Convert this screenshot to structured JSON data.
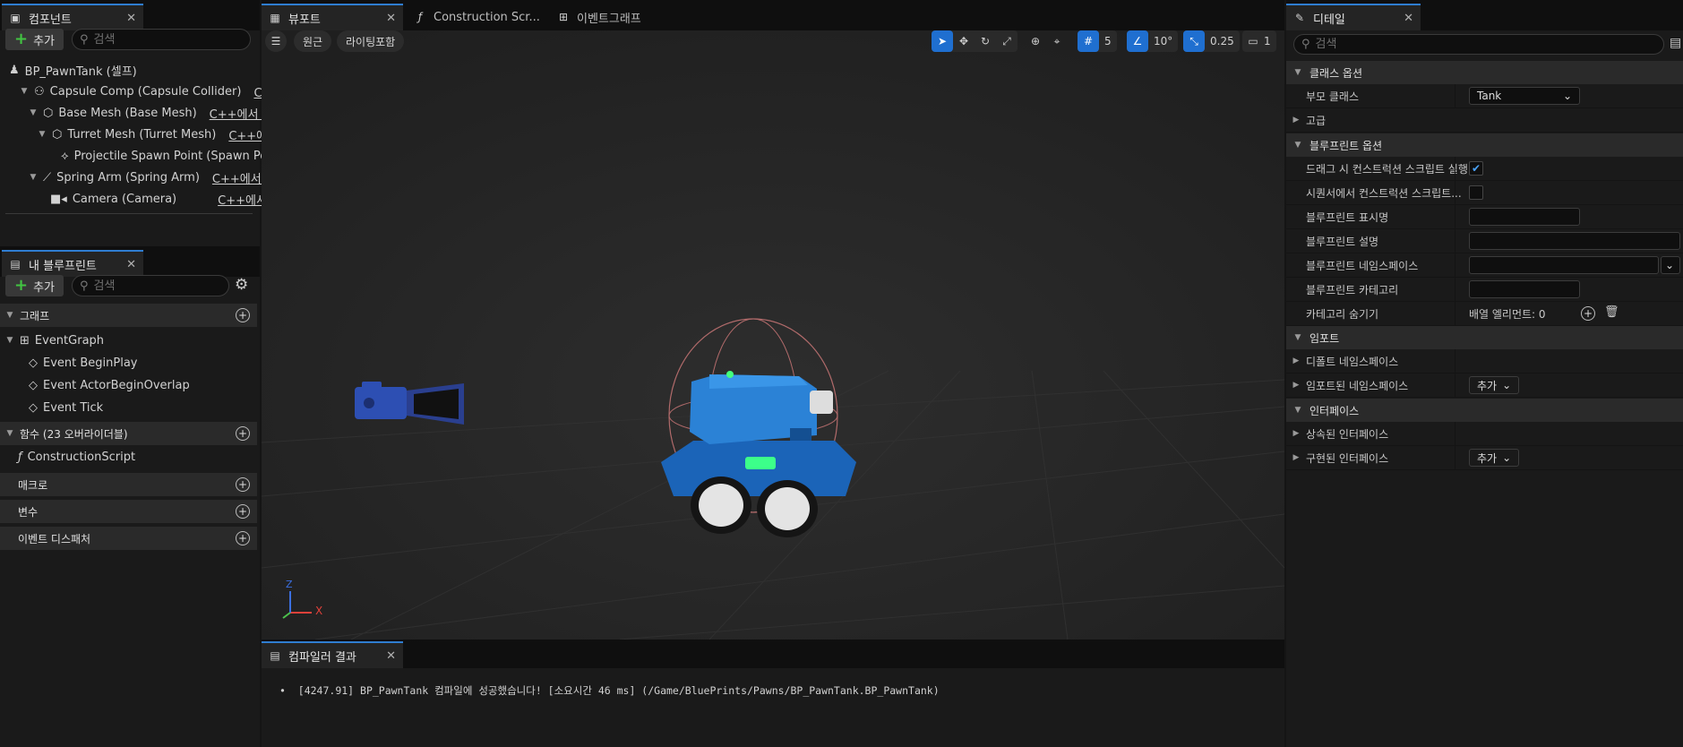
{
  "components_panel": {
    "tab_title": "컴포넌트",
    "add_label": "추가",
    "search_placeholder": "검색",
    "root": "BP_PawnTank (셀프)",
    "items": [
      {
        "label": "Capsule Comp (Capsule Collider)",
        "edit": "C++에"
      },
      {
        "label": "Base Mesh (Base Mesh)",
        "edit": "C++에서 편집"
      },
      {
        "label": "Turret Mesh (Turret Mesh)",
        "edit": "C++에서"
      },
      {
        "label": "Projectile Spawn Point (Spawn Poi",
        "edit": ""
      },
      {
        "label": "Spring Arm (Spring Arm)",
        "edit": "C++에서 편집"
      },
      {
        "label": "Camera (Camera)",
        "edit": "C++에서 편집"
      }
    ]
  },
  "blueprint_panel": {
    "tab_title": "내 블루프린트",
    "add_label": "추가",
    "search_placeholder": "검색",
    "graph_header": "그래프",
    "event_graph": "EventGraph",
    "events": [
      "Event BeginPlay",
      "Event ActorBeginOverlap",
      "Event Tick"
    ],
    "functions_header": "함수 (23 오버라이더블)",
    "construction_script": "ConstructionScript",
    "macros_header": "매크로",
    "variables_header": "변수",
    "dispatchers_header": "이벤트 디스패처"
  },
  "editor_tabs": {
    "viewport": "뷰포트",
    "construction": "Construction Scr...",
    "event_graph": "이벤트그래프"
  },
  "viewport": {
    "perspective": "원근",
    "lighting": "라이팅포함",
    "grid_snap": "5",
    "rotation_snap": "10°",
    "scale_snap": "0.25",
    "camera_speed": "1",
    "axis_x": "X",
    "axis_z": "Z",
    "colors": {
      "accent": "#1f6fd0",
      "background": "#262626"
    }
  },
  "compiler": {
    "tab_title": "컴파일러 결과",
    "message": "[4247.91] BP_PawnTank 컴파일에 성공했습니다! [소요시간 46 ms] (/Game/BluePrints/Pawns/BP_PawnTank.BP_PawnTank)"
  },
  "details": {
    "tab_title": "디테일",
    "search_placeholder": "검색",
    "class_options": "클래스 옵션",
    "parent_class_label": "부모 클래스",
    "parent_class_value": "Tank",
    "advanced": "고급",
    "blueprint_options": "블루프린트 옵션",
    "run_construction_on_drag": "드래그 시 컨스트럭션 스크립트 실행",
    "run_construction_in_sequencer": "시퀀서에서 컨스트럭션 스크립트...",
    "bp_display_name": "블루프린트 표시명",
    "bp_description": "블루프린트 설명",
    "bp_namespace": "블루프린트 네임스페이스",
    "bp_category": "블루프린트 카테고리",
    "hide_categories": "카테고리 숨기기",
    "array_elements": "배열 엘리먼트: 0",
    "imports": "임포트",
    "default_namespaces": "디폴트 네임스페이스",
    "imported_namespaces": "임포트된 네임스페이스",
    "add": "추가",
    "interfaces": "인터페이스",
    "inherited_interfaces": "상속된 인터페이스",
    "implemented_interfaces": "구현된 인터페이스"
  }
}
